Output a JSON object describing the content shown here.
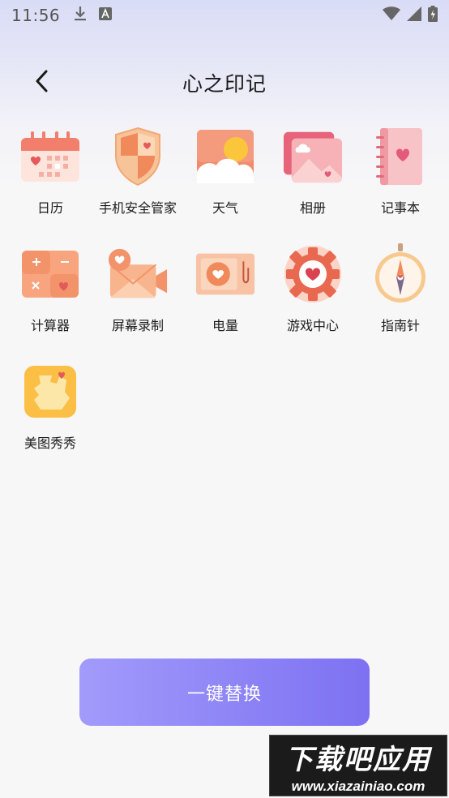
{
  "status_bar": {
    "time": "11:56"
  },
  "header": {
    "title": "心之印记"
  },
  "apps": [
    {
      "label": "日历",
      "icon": "calendar-icon"
    },
    {
      "label": "手机安全管家",
      "icon": "shield-icon"
    },
    {
      "label": "天气",
      "icon": "weather-icon"
    },
    {
      "label": "相册",
      "icon": "album-icon"
    },
    {
      "label": "记事本",
      "icon": "notebook-icon"
    },
    {
      "label": "计算器",
      "icon": "calculator-icon"
    },
    {
      "label": "屏幕录制",
      "icon": "screen-recorder-icon"
    },
    {
      "label": "电量",
      "icon": "battery-icon"
    },
    {
      "label": "游戏中心",
      "icon": "game-center-icon"
    },
    {
      "label": "指南针",
      "icon": "compass-icon"
    },
    {
      "label": "美图秀秀",
      "icon": "meitu-icon"
    }
  ],
  "actions": {
    "replace_label": "一键替换"
  },
  "watermark": {
    "title": "下载吧应用",
    "url": "www.xiazainiao.com"
  }
}
